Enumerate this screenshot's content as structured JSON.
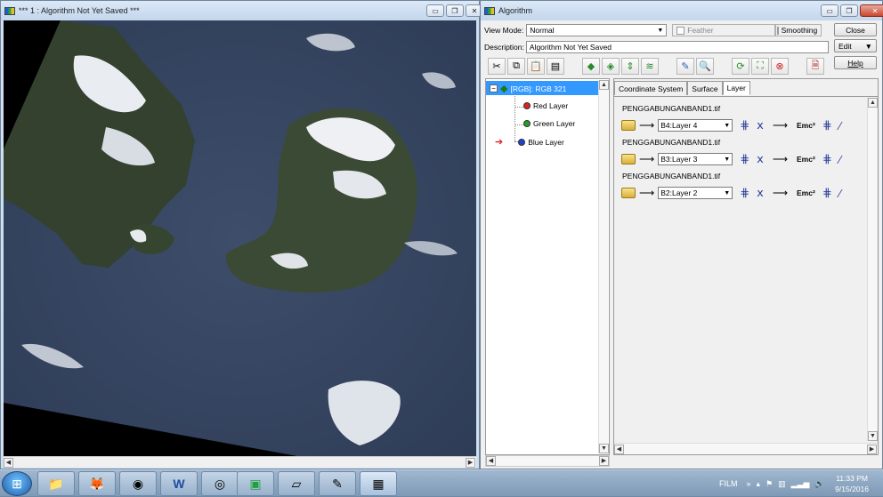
{
  "image_window": {
    "title": "*** 1 : Algorithm Not Yet Saved ***",
    "buttons": {
      "minimize": "▭",
      "restore": "❐",
      "close": "✕"
    }
  },
  "algorithm_window": {
    "title": "Algorithm",
    "view_mode_label": "View Mode:",
    "view_mode_value": "Normal",
    "feather_label": "Feather",
    "smoothing_label": "Smoothing",
    "description_label": "Description:",
    "description_value": "Algorithm Not Yet Saved",
    "close_btn": "Close",
    "edit_btn": "Edit",
    "help_btn": "Help",
    "toolbar_icons": [
      "cut-icon",
      "copy-icon",
      "paste-icon",
      "duplicate-icon",
      "add-layer-icon",
      "add-surface-icon",
      "move-layer-icon",
      "stack-icon",
      "page-edit-icon",
      "zoom-page-icon",
      "refresh-icon",
      "zoom-fit-icon",
      "stop-icon",
      "document-icon"
    ],
    "tree": {
      "root": "[RGB]: RGB 321",
      "items": [
        {
          "label": "Red Layer",
          "color": "#e02020",
          "tag": "R"
        },
        {
          "label": "Green Layer",
          "color": "#20a020",
          "tag": "G"
        },
        {
          "label": "Blue Layer",
          "color": "#2040d0",
          "tag": "B"
        }
      ],
      "marker": "➔"
    },
    "tabs": [
      "Coordinate System",
      "Surface",
      "Layer"
    ],
    "layer_rows": [
      {
        "file": "PENGGABUNGANBAND1.tif",
        "band": "B4:Layer 4"
      },
      {
        "file": "PENGGABUNGANBAND1.tif",
        "band": "B3:Layer 3"
      },
      {
        "file": "PENGGABUNGANBAND1.tif",
        "band": "B2:Layer 2"
      }
    ],
    "formula_text": "Emc²"
  },
  "taskbar": {
    "tray_label": "FILM",
    "time": "11:33 PM",
    "date": "9/15/2016"
  }
}
